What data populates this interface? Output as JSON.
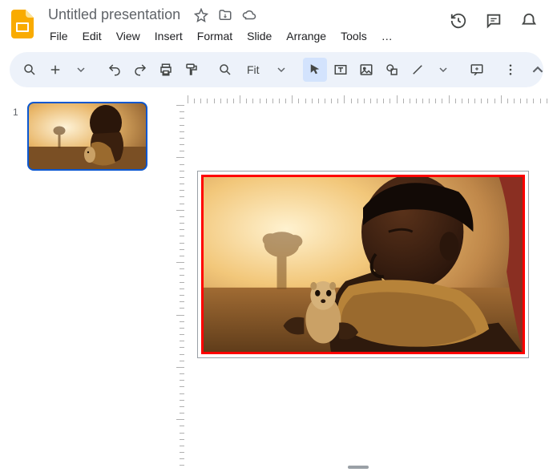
{
  "title": "Untitled presentation",
  "menus": {
    "file": "File",
    "edit": "Edit",
    "view": "View",
    "insert": "Insert",
    "format": "Format",
    "slide": "Slide",
    "arrange": "Arrange",
    "tools": "Tools",
    "more": "…"
  },
  "toolbar": {
    "zoom_label": "Fit"
  },
  "filmstrip": {
    "thumb1_num": "1"
  }
}
